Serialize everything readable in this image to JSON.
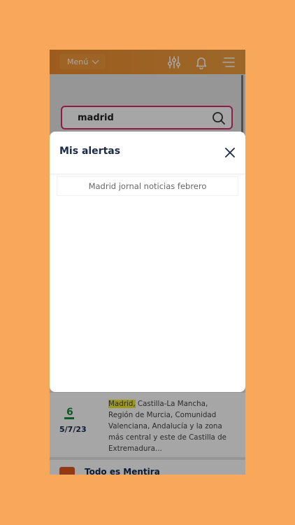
{
  "header": {
    "menu_label": "Menú",
    "icons": [
      "sliders-icon",
      "bell-icon",
      "hamburger-icon"
    ]
  },
  "search": {
    "value": "madrid"
  },
  "modal": {
    "title": "Mis alertas",
    "alerts": [
      "Madrid jornal noticias febrero"
    ]
  },
  "result": {
    "date": "5/7/23",
    "highlight": "Madrid,",
    "excerpt": " Castilla-La Mancha, Región de Murcia, Comunidad Valenciana, Andalucía y la zona más central y este de Castilla de Extremadura..."
  },
  "next_item": {
    "title": "Todo es Mentira"
  },
  "colors": {
    "background": "#F9A75A",
    "accent": "#d92b6c",
    "highlight": "#f2ec2a"
  }
}
